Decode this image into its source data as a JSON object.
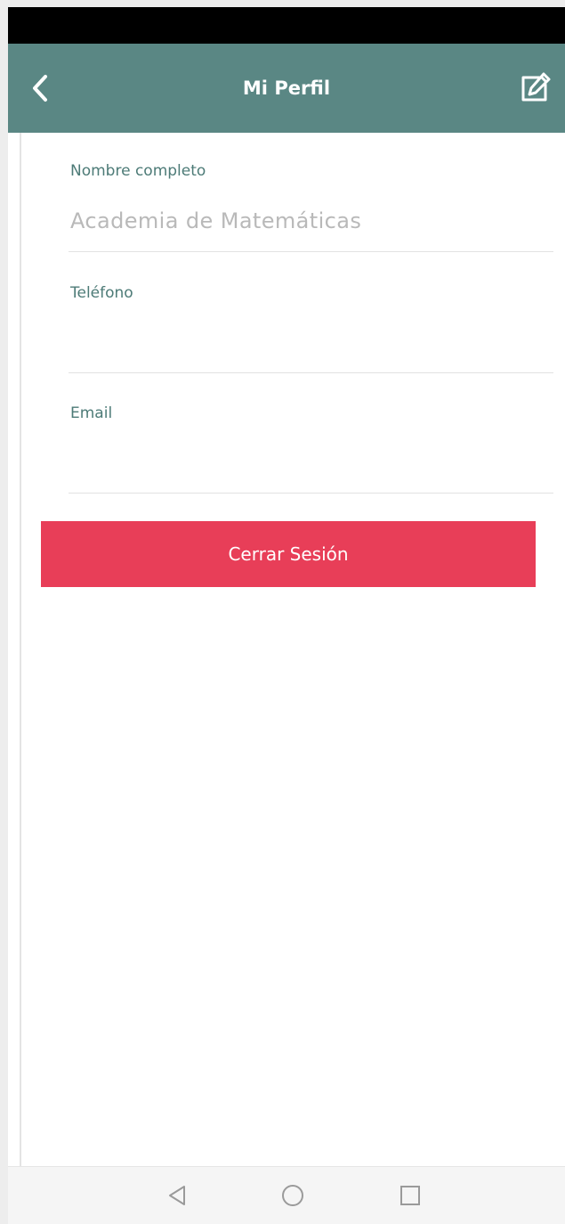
{
  "app_bar": {
    "title": "Mi Perfil",
    "back_icon": "chevron-left-icon",
    "edit_icon": "edit-icon",
    "background": "#5a8784"
  },
  "fields": {
    "nombre": {
      "label": "Nombre completo",
      "value": "Academia de Matemáticas"
    },
    "telefono": {
      "label": "Teléfono",
      "value": ""
    },
    "email": {
      "label": "Email",
      "value": ""
    }
  },
  "logout_button": {
    "label": "Cerrar Sesión",
    "color": "#e83e58"
  },
  "nav_bar": {
    "back_icon": "triangle-back-icon",
    "home_icon": "circle-home-icon",
    "recents_icon": "square-recents-icon"
  }
}
